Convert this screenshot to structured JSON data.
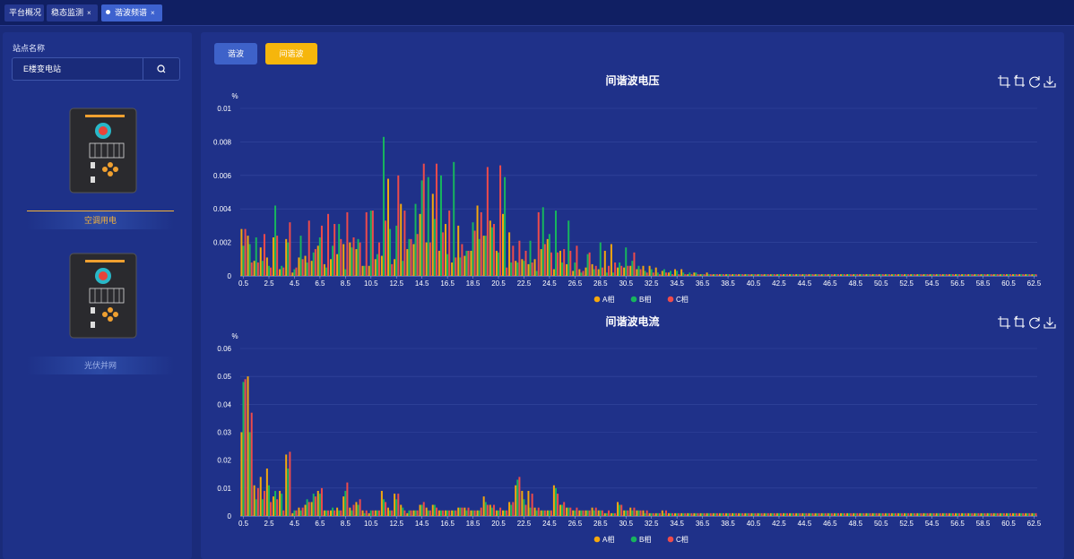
{
  "tabs": [
    {
      "label": "平台概况"
    },
    {
      "label": "稳态监测",
      "close": "×"
    },
    {
      "label": "谐波频谱",
      "close": "×"
    }
  ],
  "sidebar": {
    "site_label": "站点名称",
    "site_value": "E楼变电站",
    "devices": [
      {
        "name": "空调用电"
      },
      {
        "name": "光伏并网"
      }
    ]
  },
  "buttons": {
    "harmonic": "谐波",
    "interharmonic": "间谐波"
  },
  "colors": {
    "A": "#f5a70d",
    "B": "#17b55d",
    "C": "#ee4b4b",
    "background": "#1a2b7a",
    "panel": "#1f3189"
  },
  "toolbox_icons": [
    "zoom-icon",
    "zoom-reset-icon",
    "restore-icon",
    "download-icon"
  ],
  "chart_data": [
    {
      "type": "bar",
      "title": "间谐波电压",
      "ylabel": "%",
      "ylim": [
        0,
        0.01
      ],
      "yticks": [
        "0",
        "0.002",
        "0.004",
        "0.006",
        "0.008",
        "0.01"
      ],
      "xticks": [
        "0.5",
        "2.5",
        "4.5",
        "6.5",
        "8.5",
        "10.5",
        "12.5",
        "14.5",
        "16.5",
        "18.5",
        "20.5",
        "22.5",
        "24.5",
        "26.5",
        "28.5",
        "30.5",
        "32.5",
        "34.5",
        "36.5",
        "38.5",
        "40.5",
        "42.5",
        "44.5",
        "46.5",
        "48.5",
        "50.5",
        "52.5",
        "54.5",
        "56.5",
        "58.5",
        "60.5",
        "62.5"
      ],
      "x_start": 0.5,
      "x_step": 0.5,
      "legend": [
        "A相",
        "B相",
        "C相"
      ],
      "series": [
        {
          "name": "A相",
          "values": [
            0.0028,
            0.0024,
            0.0009,
            0.0017,
            0.0011,
            0.0023,
            0.0004,
            0.0022,
            0.0002,
            0.0011,
            0.0012,
            0.0009,
            0.0018,
            0.0007,
            0.001,
            0.0013,
            0.0019,
            0.002,
            0.0016,
            0.0006,
            0.0006,
            0.001,
            0.0012,
            0.0058,
            0.001,
            0.0043,
            0.0016,
            0.0019,
            0.0037,
            0.002,
            0.0049,
            0.0015,
            0.0031,
            0.0008,
            0.003,
            0.0012,
            0.0015,
            0.0042,
            0.0024,
            0.0033,
            0.0015,
            0.0037,
            0.0026,
            0.0009,
            0.001,
            0.0007,
            0.001,
            0.0016,
            0.0022,
            0.0004,
            0.0015,
            0.0007,
            0.0003,
            0.0004,
            0.0005,
            0.0007,
            0.0004,
            0.0015,
            0.0019,
            0.0005,
            0.0005,
            0.0006,
            0.0004,
            0.0006,
            0.0006,
            0.0005,
            0.0003,
            0.0002,
            0.0004,
            0.0004,
            0.0001,
            0.0002,
            0.0001,
            0.0002,
            0.0001,
            0.0001,
            0.0001,
            0.0001,
            0.0001,
            0.0001,
            0.0001,
            0.0001,
            0.0001,
            0.0001,
            0.0001,
            0.0001,
            0.0001,
            0.0001,
            0.0001,
            0.0001,
            0.0001,
            0.0001,
            0.0001,
            0.0001,
            0.0001,
            0.0001,
            0.0001,
            0.0001,
            0.0001,
            0.0001,
            0.0001,
            0.0001,
            0.0001,
            0.0001,
            0.0001,
            0.0001,
            0.0001,
            0.0001,
            0.0001,
            0.0001,
            0.0001,
            0.0001,
            0.0001,
            0.0001,
            0.0001,
            0.0001,
            0.0001,
            0.0001,
            0.0001,
            0.0001,
            0.0001,
            0.0001,
            0.0001,
            0.0001,
            0.0001
          ]
        },
        {
          "name": "B相",
          "values": [
            0.0018,
            0.0019,
            0.0023,
            0.0009,
            0.0006,
            0.0042,
            0.0006,
            0.002,
            0.0004,
            0.0024,
            0.0008,
            0.0014,
            0.0023,
            0.0005,
            0.0018,
            0.0031,
            0.0004,
            0.0017,
            0.0022,
            0.0006,
            0.0039,
            0.0013,
            0.0083,
            0.0028,
            0.003,
            0.0009,
            0.0022,
            0.0043,
            0.0057,
            0.0059,
            0.0034,
            0.006,
            0.0013,
            0.0068,
            0.0011,
            0.0015,
            0.0032,
            0.0022,
            0.0024,
            0.0029,
            0.0014,
            0.0059,
            0.0008,
            0.0008,
            0.0009,
            0.0021,
            0.0003,
            0.0041,
            0.0025,
            0.0039,
            0.0008,
            0.0033,
            0.0008,
            0.0002,
            0.0013,
            0.0004,
            0.002,
            0.0002,
            0.0002,
            0.0008,
            0.0017,
            0.0009,
            0.0006,
            0.0003,
            0.0004,
            0.0002,
            0.0004,
            0.0003,
            0.0003,
            0.0002,
            0.0002,
            0.0002,
            0.0001,
            0.0001,
            0.0001,
            0.0001,
            0.0001,
            0.0001,
            0.0001,
            0.0001,
            0.0001,
            0.0001,
            0.0001,
            0.0001,
            0.0001,
            0.0001,
            0.0001,
            0.0001,
            0.0001,
            0.0001,
            0.0001,
            0.0001,
            0.0001,
            0.0001,
            0.0001,
            0.0001,
            0.0001,
            0.0001,
            0.0001,
            0.0001,
            0.0001,
            0.0001,
            0.0001,
            0.0001,
            0.0001,
            0.0001,
            0.0001,
            0.0001,
            0.0001,
            0.0001,
            0.0001,
            0.0001,
            0.0001,
            0.0001,
            0.0001,
            0.0001,
            0.0001,
            0.0001,
            0.0001,
            0.0001,
            0.0001,
            0.0001,
            0.0001,
            0.0001,
            0.0001
          ]
        },
        {
          "name": "C相",
          "values": [
            0.0028,
            0.0008,
            0.0008,
            0.0025,
            0.0005,
            0.0024,
            0.0005,
            0.0032,
            0.0005,
            0.001,
            0.0033,
            0.0016,
            0.003,
            0.0037,
            0.0031,
            0.0022,
            0.0038,
            0.0023,
            0.002,
            0.0038,
            0.0039,
            0.002,
            0.0033,
            0.0007,
            0.006,
            0.0039,
            0.0022,
            0.0025,
            0.0067,
            0.002,
            0.0067,
            0.0026,
            0.0039,
            0.0011,
            0.0019,
            0.0015,
            0.0027,
            0.0038,
            0.0065,
            0.0031,
            0.0066,
            0.0005,
            0.0018,
            0.0021,
            0.0015,
            0.0008,
            0.0038,
            0.0019,
            0.0014,
            0.0014,
            0.0016,
            0.0015,
            0.0018,
            0.0003,
            0.0014,
            0.0006,
            0.0005,
            0.0006,
            0.0008,
            0.0006,
            0.0006,
            0.0014,
            0.0004,
            0.0002,
            0.0002,
            0.0001,
            0.0002,
            0.0001,
            0.0001,
            0.0001,
            0.0001,
            0.0001,
            0.0001,
            0.0001,
            0.0001,
            0.0001,
            0.0001,
            0.0001,
            0.0001,
            0.0001,
            0.0001,
            0.0001,
            0.0001,
            0.0001,
            0.0001,
            0.0001,
            0.0001,
            0.0001,
            0.0001,
            0.0001,
            0.0001,
            0.0001,
            0.0001,
            0.0001,
            0.0001,
            0.0001,
            0.0001,
            0.0001,
            0.0001,
            0.0001,
            0.0001,
            0.0001,
            0.0001,
            0.0001,
            0.0001,
            0.0001,
            0.0001,
            0.0001,
            0.0001,
            0.0001,
            0.0001,
            0.0001,
            0.0001,
            0.0001,
            0.0001,
            0.0001,
            0.0001,
            0.0001,
            0.0001,
            0.0001,
            0.0001,
            0.0001,
            0.0001,
            0.0001,
            0.0001
          ]
        }
      ]
    },
    {
      "type": "bar",
      "title": "间谐波电流",
      "ylabel": "%",
      "ylim": [
        0,
        0.06
      ],
      "yticks": [
        "0",
        "0.01",
        "0.02",
        "0.03",
        "0.04",
        "0.05",
        "0.06"
      ],
      "xticks": [
        "0.5",
        "2.5",
        "4.5",
        "6.5",
        "8.5",
        "10.5",
        "12.5",
        "14.5",
        "16.5",
        "18.5",
        "20.5",
        "22.5",
        "24.5",
        "26.5",
        "28.5",
        "30.5",
        "32.5",
        "34.5",
        "36.5",
        "38.5",
        "40.5",
        "42.5",
        "44.5",
        "46.5",
        "48.5",
        "50.5",
        "52.5",
        "54.5",
        "56.5",
        "58.5",
        "60.5",
        "62.5"
      ],
      "x_start": 0.5,
      "x_step": 0.5,
      "legend": [
        "A相",
        "B相",
        "C相"
      ],
      "series": [
        {
          "name": "A相",
          "values": [
            0.03,
            0.05,
            0.011,
            0.014,
            0.017,
            0.007,
            0.009,
            0.022,
            0.001,
            0.003,
            0.004,
            0.005,
            0.009,
            0.002,
            0.002,
            0.003,
            0.007,
            0.003,
            0.005,
            0.002,
            0.001,
            0.002,
            0.009,
            0.003,
            0.008,
            0.004,
            0.001,
            0.002,
            0.004,
            0.003,
            0.004,
            0.002,
            0.002,
            0.002,
            0.003,
            0.003,
            0.002,
            0.002,
            0.007,
            0.004,
            0.002,
            0.002,
            0.005,
            0.011,
            0.009,
            0.009,
            0.003,
            0.002,
            0.002,
            0.011,
            0.004,
            0.003,
            0.002,
            0.002,
            0.002,
            0.003,
            0.002,
            0.001,
            0.001,
            0.005,
            0.002,
            0.003,
            0.002,
            0.002,
            0.001,
            0.001,
            0.002,
            0.001,
            0.001,
            0.001,
            0.001,
            0.001,
            0.001,
            0.001,
            0.001,
            0.001,
            0.001,
            0.001,
            0.001,
            0.001,
            0.001,
            0.001,
            0.001,
            0.001,
            0.001,
            0.001,
            0.001,
            0.001,
            0.001,
            0.001,
            0.001,
            0.001,
            0.001,
            0.001,
            0.001,
            0.001,
            0.001,
            0.001,
            0.001,
            0.001,
            0.001,
            0.001,
            0.001,
            0.001,
            0.001,
            0.001,
            0.001,
            0.001,
            0.001,
            0.001,
            0.001,
            0.001,
            0.001,
            0.001,
            0.001,
            0.001,
            0.001,
            0.001,
            0.001,
            0.001,
            0.001,
            0.001,
            0.001,
            0.001,
            0.001
          ]
        },
        {
          "name": "B相",
          "values": [
            0.048,
            0.03,
            0.006,
            0.006,
            0.011,
            0.009,
            0.008,
            0.017,
            0.002,
            0.002,
            0.006,
            0.008,
            0.008,
            0.002,
            0.003,
            0.002,
            0.009,
            0.002,
            0.004,
            0.001,
            0.002,
            0.002,
            0.006,
            0.002,
            0.006,
            0.003,
            0.002,
            0.002,
            0.004,
            0.002,
            0.004,
            0.002,
            0.002,
            0.002,
            0.003,
            0.002,
            0.002,
            0.002,
            0.005,
            0.003,
            0.002,
            0.002,
            0.004,
            0.013,
            0.006,
            0.003,
            0.002,
            0.002,
            0.002,
            0.01,
            0.004,
            0.003,
            0.002,
            0.002,
            0.002,
            0.002,
            0.002,
            0.001,
            0.001,
            0.004,
            0.002,
            0.002,
            0.002,
            0.001,
            0.001,
            0.001,
            0.001,
            0.001,
            0.001,
            0.001,
            0.001,
            0.001,
            0.001,
            0.001,
            0.001,
            0.001,
            0.001,
            0.001,
            0.001,
            0.001,
            0.001,
            0.001,
            0.001,
            0.001,
            0.001,
            0.001,
            0.001,
            0.001,
            0.001,
            0.001,
            0.001,
            0.001,
            0.001,
            0.001,
            0.001,
            0.001,
            0.001,
            0.001,
            0.001,
            0.001,
            0.001,
            0.001,
            0.001,
            0.001,
            0.001,
            0.001,
            0.001,
            0.001,
            0.001,
            0.001,
            0.001,
            0.001,
            0.001,
            0.001,
            0.001,
            0.001,
            0.001,
            0.001,
            0.001,
            0.001,
            0.001,
            0.001,
            0.001,
            0.001,
            0.001
          ]
        },
        {
          "name": "C相",
          "values": [
            0.049,
            0.037,
            0.01,
            0.009,
            0.005,
            0.006,
            0.002,
            0.023,
            0.002,
            0.003,
            0.005,
            0.007,
            0.01,
            0.002,
            0.002,
            0.002,
            0.012,
            0.004,
            0.006,
            0.002,
            0.002,
            0.002,
            0.005,
            0.002,
            0.008,
            0.002,
            0.002,
            0.002,
            0.005,
            0.002,
            0.003,
            0.002,
            0.002,
            0.002,
            0.003,
            0.003,
            0.002,
            0.003,
            0.004,
            0.004,
            0.003,
            0.002,
            0.005,
            0.014,
            0.004,
            0.008,
            0.003,
            0.002,
            0.002,
            0.008,
            0.005,
            0.003,
            0.003,
            0.002,
            0.002,
            0.003,
            0.002,
            0.002,
            0.001,
            0.004,
            0.002,
            0.003,
            0.002,
            0.002,
            0.001,
            0.001,
            0.002,
            0.001,
            0.001,
            0.001,
            0.001,
            0.001,
            0.001,
            0.001,
            0.001,
            0.001,
            0.001,
            0.001,
            0.001,
            0.001,
            0.001,
            0.001,
            0.001,
            0.001,
            0.001,
            0.001,
            0.001,
            0.001,
            0.001,
            0.001,
            0.001,
            0.001,
            0.001,
            0.001,
            0.001,
            0.001,
            0.001,
            0.001,
            0.001,
            0.001,
            0.001,
            0.001,
            0.001,
            0.001,
            0.001,
            0.001,
            0.001,
            0.001,
            0.001,
            0.001,
            0.001,
            0.001,
            0.001,
            0.001,
            0.001,
            0.001,
            0.001,
            0.001,
            0.001,
            0.001,
            0.001,
            0.001,
            0.001,
            0.001,
            0.001
          ]
        }
      ]
    }
  ]
}
